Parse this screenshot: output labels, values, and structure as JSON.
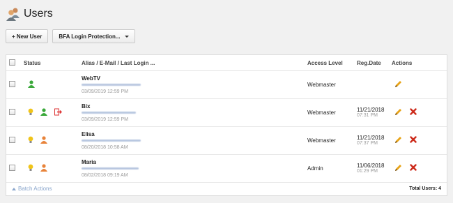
{
  "page": {
    "title": "Users"
  },
  "toolbar": {
    "new_user_label": "+ New User",
    "bfa_label": "BFA Login Protection..."
  },
  "table": {
    "headers": {
      "status": "Status",
      "alias": "Alias / E-Mail / Last Login ...",
      "access": "Access Level",
      "reg": "Reg.Date",
      "actions": "Actions"
    },
    "rows": [
      {
        "name": "WebTV",
        "last_login": "03/09/2019 12:59 PM",
        "access_level": "Webmaster",
        "reg_date": "",
        "reg_time": "",
        "status_icons": [
          "user-green-icon"
        ]
      },
      {
        "name": "Bix",
        "last_login": "03/09/2019 12:59 PM",
        "access_level": "Webmaster",
        "reg_date": "11/21/2018",
        "reg_time": "07:31 PM",
        "status_icons": [
          "lightbulb-icon",
          "user-green-icon",
          "logout-icon"
        ]
      },
      {
        "name": "Elisa",
        "last_login": "08/20/2018 10:58 AM",
        "access_level": "Webmaster",
        "reg_date": "11/21/2018",
        "reg_time": "07:37 PM",
        "status_icons": [
          "lightbulb-icon",
          "user-orange-icon"
        ]
      },
      {
        "name": "Maria",
        "last_login": "08/02/2018 09:19 AM",
        "access_level": "Admin",
        "reg_date": "11/06/2018",
        "reg_time": "01:29 PM",
        "status_icons": [
          "lightbulb-icon",
          "user-orange-icon"
        ]
      }
    ]
  },
  "footer": {
    "batch_label": "Batch Actions",
    "total_label": "Total Users: 4"
  },
  "colors": {
    "background": "#f1f1f1",
    "link": "#8aa6cc",
    "delete": "#cc2a1a",
    "edit": "#e8a317",
    "user_green": "#3aa83a",
    "user_orange": "#e8833a",
    "bulb": "#f0c419"
  }
}
